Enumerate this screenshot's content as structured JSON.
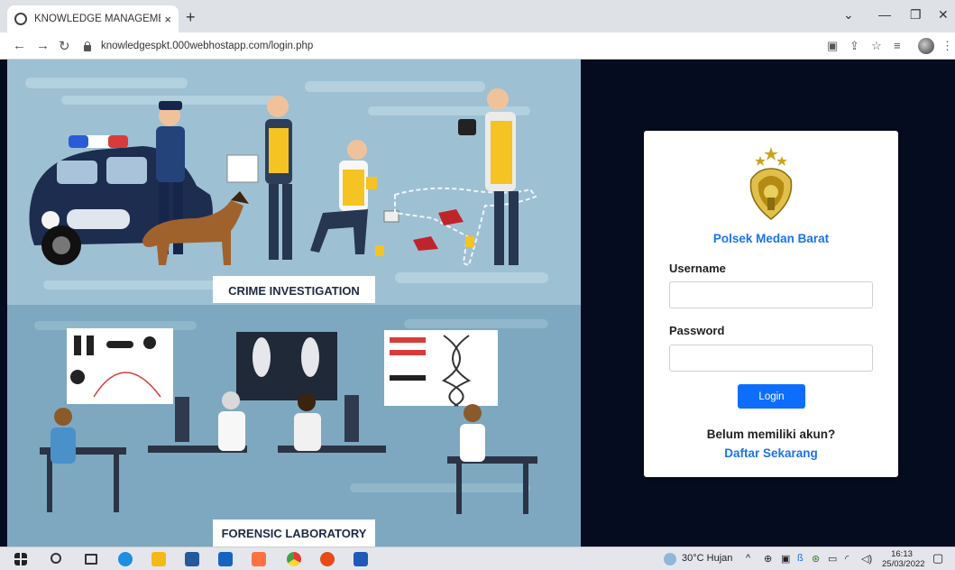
{
  "browser": {
    "tab_title": "KNOWLEDGE MANAGEMENT SYSTEM",
    "tab_close": "×",
    "new_tab": "+",
    "url": "knowledgespkt.000webhostapp.com/login.php",
    "window_controls": [
      "⌄",
      "—",
      "❐",
      "✕"
    ]
  },
  "illustration": {
    "banner_top": "CRIME INVESTIGATION",
    "banner_bottom": "FORENSIC LABORATORY"
  },
  "login": {
    "unit_name": "Polsek Medan Barat",
    "username_label": "Username",
    "username_value": "",
    "password_label": "Password",
    "password_value": "",
    "login_button": "Login",
    "no_account_text": "Belum memiliki akun?",
    "signup_link": "Daftar Sekarang"
  },
  "taskbar": {
    "weather": "30°C  Hujan",
    "time": "16:13",
    "date": "25/03/2022"
  }
}
